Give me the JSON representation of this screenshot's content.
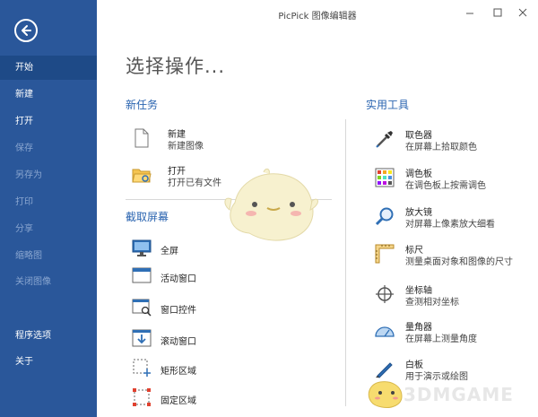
{
  "window": {
    "title": "PicPick 图像编辑器"
  },
  "sidebar": {
    "items": [
      {
        "label": "开始",
        "state": "active"
      },
      {
        "label": "新建",
        "state": "enabled"
      },
      {
        "label": "打开",
        "state": "enabled"
      },
      {
        "label": "保存",
        "state": "disabled"
      },
      {
        "label": "另存为",
        "state": "disabled"
      },
      {
        "label": "打印",
        "state": "disabled"
      },
      {
        "label": "分享",
        "state": "disabled"
      },
      {
        "label": "缩略图",
        "state": "disabled"
      },
      {
        "label": "关闭图像",
        "state": "disabled"
      },
      {
        "label": "程序选项",
        "state": "enabled"
      },
      {
        "label": "关于",
        "state": "enabled"
      }
    ]
  },
  "main": {
    "heading": "选择操作...",
    "new_task": {
      "title": "新任务",
      "items": [
        {
          "label": "新建",
          "desc": "新建图像",
          "icon": "new-file-icon"
        },
        {
          "label": "打开",
          "desc": "打开已有文件",
          "icon": "open-folder-icon"
        }
      ]
    },
    "capture": {
      "title": "截取屏幕",
      "items": [
        {
          "label": "全屏",
          "icon": "fullscreen-monitor-icon"
        },
        {
          "label": "活动窗口",
          "icon": "active-window-icon"
        },
        {
          "label": "窗口控件",
          "icon": "window-control-icon"
        },
        {
          "label": "滚动窗口",
          "icon": "scroll-window-icon"
        },
        {
          "label": "矩形区域",
          "icon": "rect-region-icon"
        },
        {
          "label": "固定区域",
          "icon": "fixed-region-icon"
        }
      ]
    },
    "tools": {
      "title": "实用工具",
      "items": [
        {
          "label": "取色器",
          "desc": "在屏幕上拾取颜色",
          "icon": "eyedropper-icon"
        },
        {
          "label": "调色板",
          "desc": "在调色板上按需调色",
          "icon": "palette-icon"
        },
        {
          "label": "放大镜",
          "desc": "对屏幕上像素放大细看",
          "icon": "magnifier-icon"
        },
        {
          "label": "标尺",
          "desc": "测量桌面对象和图像的尺寸",
          "icon": "ruler-icon"
        },
        {
          "label": "坐标轴",
          "desc": "查测相对坐标",
          "icon": "crosshair-icon"
        },
        {
          "label": "量角器",
          "desc": "在屏幕上测量角度",
          "icon": "protractor-icon"
        },
        {
          "label": "白板",
          "desc": "用于演示或绘图",
          "icon": "whiteboard-pen-icon"
        }
      ]
    }
  },
  "watermark": {
    "brand": "3DMGAME",
    "sub": "在屏幕上测量角度"
  },
  "colors": {
    "sidebar": "#2a579a",
    "sidebar_active": "#1e4a87",
    "section_title": "#2a64b0",
    "accent_icon": "#2f6fb5"
  }
}
